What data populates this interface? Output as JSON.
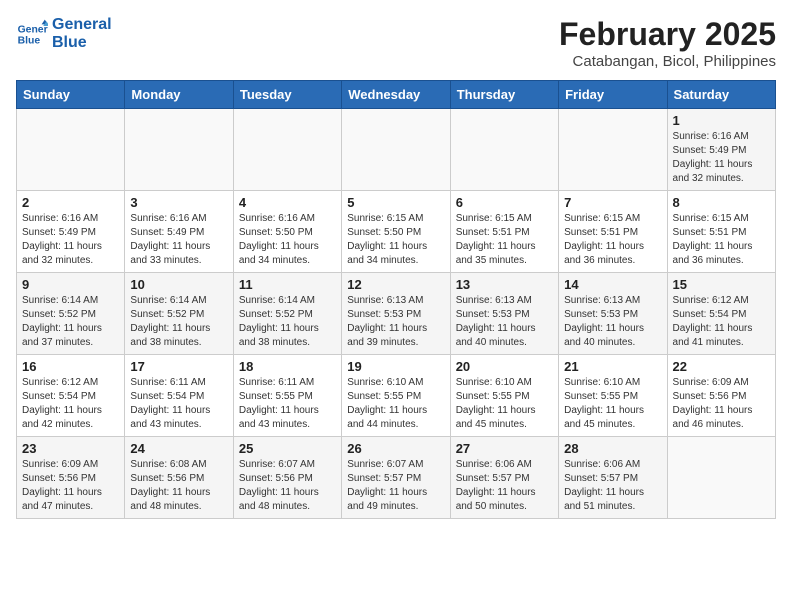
{
  "header": {
    "logo_line1": "General",
    "logo_line2": "Blue",
    "title": "February 2025",
    "subtitle": "Catabangan, Bicol, Philippines"
  },
  "weekdays": [
    "Sunday",
    "Monday",
    "Tuesday",
    "Wednesday",
    "Thursday",
    "Friday",
    "Saturday"
  ],
  "weeks": [
    [
      {
        "day": "",
        "info": ""
      },
      {
        "day": "",
        "info": ""
      },
      {
        "day": "",
        "info": ""
      },
      {
        "day": "",
        "info": ""
      },
      {
        "day": "",
        "info": ""
      },
      {
        "day": "",
        "info": ""
      },
      {
        "day": "1",
        "info": "Sunrise: 6:16 AM\nSunset: 5:49 PM\nDaylight: 11 hours\nand 32 minutes."
      }
    ],
    [
      {
        "day": "2",
        "info": "Sunrise: 6:16 AM\nSunset: 5:49 PM\nDaylight: 11 hours\nand 32 minutes."
      },
      {
        "day": "3",
        "info": "Sunrise: 6:16 AM\nSunset: 5:49 PM\nDaylight: 11 hours\nand 33 minutes."
      },
      {
        "day": "4",
        "info": "Sunrise: 6:16 AM\nSunset: 5:50 PM\nDaylight: 11 hours\nand 34 minutes."
      },
      {
        "day": "5",
        "info": "Sunrise: 6:15 AM\nSunset: 5:50 PM\nDaylight: 11 hours\nand 34 minutes."
      },
      {
        "day": "6",
        "info": "Sunrise: 6:15 AM\nSunset: 5:51 PM\nDaylight: 11 hours\nand 35 minutes."
      },
      {
        "day": "7",
        "info": "Sunrise: 6:15 AM\nSunset: 5:51 PM\nDaylight: 11 hours\nand 36 minutes."
      },
      {
        "day": "8",
        "info": "Sunrise: 6:15 AM\nSunset: 5:51 PM\nDaylight: 11 hours\nand 36 minutes."
      }
    ],
    [
      {
        "day": "9",
        "info": "Sunrise: 6:14 AM\nSunset: 5:52 PM\nDaylight: 11 hours\nand 37 minutes."
      },
      {
        "day": "10",
        "info": "Sunrise: 6:14 AM\nSunset: 5:52 PM\nDaylight: 11 hours\nand 38 minutes."
      },
      {
        "day": "11",
        "info": "Sunrise: 6:14 AM\nSunset: 5:52 PM\nDaylight: 11 hours\nand 38 minutes."
      },
      {
        "day": "12",
        "info": "Sunrise: 6:13 AM\nSunset: 5:53 PM\nDaylight: 11 hours\nand 39 minutes."
      },
      {
        "day": "13",
        "info": "Sunrise: 6:13 AM\nSunset: 5:53 PM\nDaylight: 11 hours\nand 40 minutes."
      },
      {
        "day": "14",
        "info": "Sunrise: 6:13 AM\nSunset: 5:53 PM\nDaylight: 11 hours\nand 40 minutes."
      },
      {
        "day": "15",
        "info": "Sunrise: 6:12 AM\nSunset: 5:54 PM\nDaylight: 11 hours\nand 41 minutes."
      }
    ],
    [
      {
        "day": "16",
        "info": "Sunrise: 6:12 AM\nSunset: 5:54 PM\nDaylight: 11 hours\nand 42 minutes."
      },
      {
        "day": "17",
        "info": "Sunrise: 6:11 AM\nSunset: 5:54 PM\nDaylight: 11 hours\nand 43 minutes."
      },
      {
        "day": "18",
        "info": "Sunrise: 6:11 AM\nSunset: 5:55 PM\nDaylight: 11 hours\nand 43 minutes."
      },
      {
        "day": "19",
        "info": "Sunrise: 6:10 AM\nSunset: 5:55 PM\nDaylight: 11 hours\nand 44 minutes."
      },
      {
        "day": "20",
        "info": "Sunrise: 6:10 AM\nSunset: 5:55 PM\nDaylight: 11 hours\nand 45 minutes."
      },
      {
        "day": "21",
        "info": "Sunrise: 6:10 AM\nSunset: 5:55 PM\nDaylight: 11 hours\nand 45 minutes."
      },
      {
        "day": "22",
        "info": "Sunrise: 6:09 AM\nSunset: 5:56 PM\nDaylight: 11 hours\nand 46 minutes."
      }
    ],
    [
      {
        "day": "23",
        "info": "Sunrise: 6:09 AM\nSunset: 5:56 PM\nDaylight: 11 hours\nand 47 minutes."
      },
      {
        "day": "24",
        "info": "Sunrise: 6:08 AM\nSunset: 5:56 PM\nDaylight: 11 hours\nand 48 minutes."
      },
      {
        "day": "25",
        "info": "Sunrise: 6:07 AM\nSunset: 5:56 PM\nDaylight: 11 hours\nand 48 minutes."
      },
      {
        "day": "26",
        "info": "Sunrise: 6:07 AM\nSunset: 5:57 PM\nDaylight: 11 hours\nand 49 minutes."
      },
      {
        "day": "27",
        "info": "Sunrise: 6:06 AM\nSunset: 5:57 PM\nDaylight: 11 hours\nand 50 minutes."
      },
      {
        "day": "28",
        "info": "Sunrise: 6:06 AM\nSunset: 5:57 PM\nDaylight: 11 hours\nand 51 minutes."
      },
      {
        "day": "",
        "info": ""
      }
    ]
  ]
}
